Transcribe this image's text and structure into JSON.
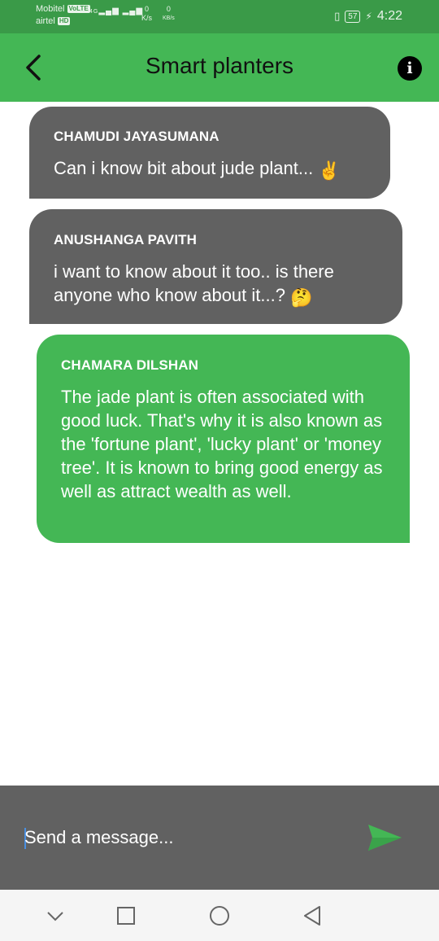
{
  "status_bar": {
    "carrier1": "Mobitel",
    "carrier1_badge": "VoLTE",
    "carrier2": "airtel",
    "carrier2_badge": "HD",
    "network": "4G",
    "speed_value": "0",
    "speed_unit": "K/s",
    "speed2_value": "0",
    "speed2_unit": "KB/s",
    "battery": "57",
    "time": "4:22"
  },
  "app_bar": {
    "title": "Smart planters",
    "back_icon": "arrow-back-icon",
    "info_icon": "info-icon"
  },
  "messages": [
    {
      "sender": "CHAMUDI JAYASUMANA",
      "text": "Can i know bit about jude plant...",
      "emoji": "✌️"
    },
    {
      "sender": "ANUSHANGA PAVITH",
      "text": "i want to know about it too.. is there anyone who know about it...?",
      "emoji": "🤔"
    },
    {
      "sender": "CHAMARA DILSHAN",
      "text": "The jade plant is often associated with good luck. That's why it is also known as the 'fortune plant', 'lucky plant' or 'money tree'. It is known to bring good energy as well as attract wealth as well."
    }
  ],
  "composer": {
    "placeholder": "Send a message...",
    "send_icon": "send-icon"
  },
  "nav_bar": {
    "icons": [
      "chevron-down-icon",
      "square-icon",
      "circle-icon",
      "triangle-back-icon"
    ]
  },
  "colors": {
    "primary_green": "#44b755",
    "status_green": "#3a9a48",
    "bubble_gray": "#616161"
  }
}
